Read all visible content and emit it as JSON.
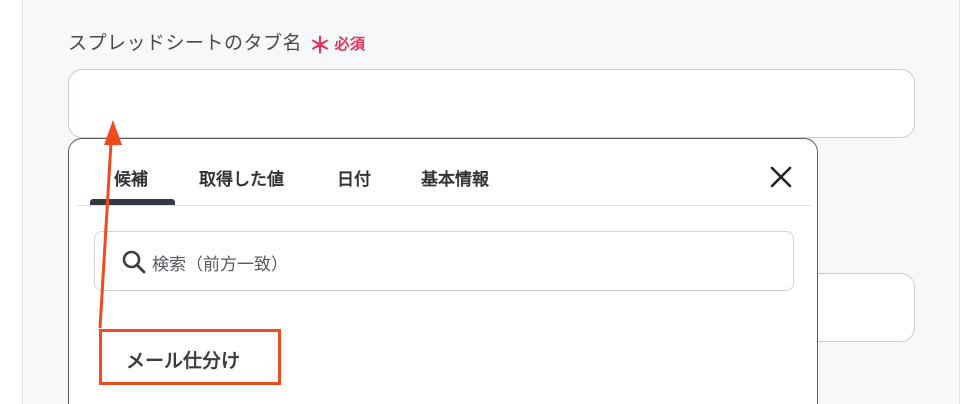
{
  "field": {
    "label": "スプレッドシートのタブ名",
    "required_mark": "＊",
    "required_text": "必須",
    "value": ""
  },
  "popup": {
    "tabs": [
      {
        "label": "候補",
        "active": true
      },
      {
        "label": "取得した値",
        "active": false
      },
      {
        "label": "日付",
        "active": false
      },
      {
        "label": "基本情報",
        "active": false
      }
    ],
    "close_icon": "close-icon",
    "search": {
      "placeholder": "検索（前方一致）"
    },
    "options": [
      {
        "label": "メール仕分け"
      }
    ]
  },
  "colors": {
    "required": "#e5335a",
    "highlight": "#f04a1e",
    "tab_active": "#333a44"
  }
}
